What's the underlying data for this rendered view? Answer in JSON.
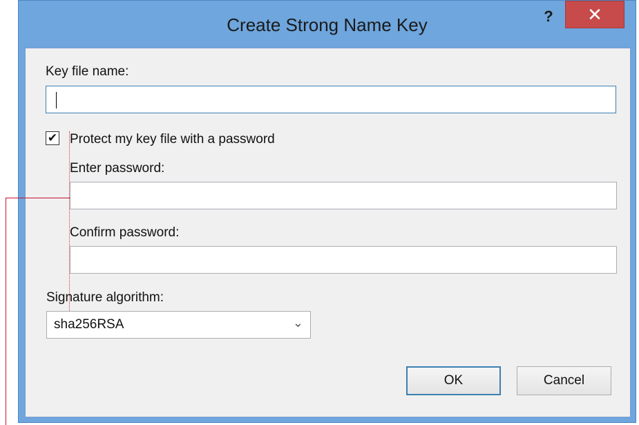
{
  "window": {
    "title": "Create Strong Name Key",
    "help_glyph": "?",
    "close_glyph": "✕"
  },
  "form": {
    "key_file_label": "Key file name:",
    "key_file_value": "",
    "protect_checkbox_label": "Protect my key file with a password",
    "protect_checked": true,
    "check_glyph": "✔",
    "enter_password_label": "Enter password:",
    "enter_password_value": "",
    "confirm_password_label": "Confirm password:",
    "confirm_password_value": "",
    "signature_algorithm_label": "Signature algorithm:",
    "signature_algorithm_value": "sha256RSA",
    "dropdown_glyph": "⌄"
  },
  "buttons": {
    "ok_label": "OK",
    "cancel_label": "Cancel"
  },
  "colors": {
    "title_bar": "#6ea6dd",
    "close_button": "#c74b4b",
    "annotation_line": "#c8102e",
    "focus_border": "#3c7fb1"
  },
  "icons": {
    "help": "help-icon",
    "close": "close-icon",
    "checkmark": "checkmark-icon",
    "dropdown": "chevron-down-icon"
  }
}
